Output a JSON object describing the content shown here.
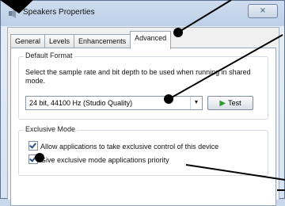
{
  "window": {
    "title": "Speakers Properties",
    "close_glyph": "⨯"
  },
  "tabs": [
    {
      "label": "General"
    },
    {
      "label": "Levels"
    },
    {
      "label": "Enhancements"
    },
    {
      "label": "Advanced",
      "active": true
    }
  ],
  "default_format": {
    "group_label": "Default Format",
    "description": "Select the sample rate and bit depth to be used when running in shared mode.",
    "selected_value": "24 bit, 44100 Hz (Studio Quality)",
    "test_label": "Test"
  },
  "exclusive_mode": {
    "group_label": "Exclusive Mode",
    "options": [
      {
        "label": "Allow applications to take exclusive control of this device",
        "checked": true
      },
      {
        "label": "Give exclusive mode applications priority",
        "checked": true
      }
    ]
  },
  "colors": {
    "accent": "#2c4f87",
    "test_play": "#2c9a2c",
    "annotation": "#000000"
  }
}
